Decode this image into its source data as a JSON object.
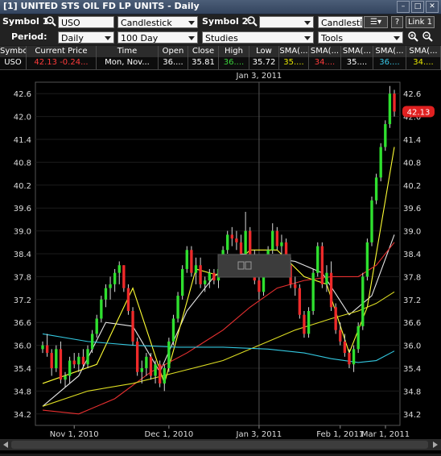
{
  "window": {
    "title": "[1] UNITED STS OIL FD LP UNITS - Daily"
  },
  "toolbar": {
    "symbol1_label": "Symbol 1:",
    "symbol1_value": "USO",
    "chart_type": "Candlestick",
    "symbol2_label": "Symbol 2:",
    "symbol2_value": "",
    "chart_type2": "Candlestic",
    "link_label": "Link 1",
    "help_label": "?",
    "period_label": "Period:",
    "period_value": "Daily",
    "range_value": "100 Day",
    "studies_value": "Studies",
    "tools_value": "Tools"
  },
  "quote": {
    "headers": [
      "Symbol",
      "Current Price",
      "Time",
      "Open",
      "Close",
      "High",
      "Low",
      "SMA(...",
      "SMA(...",
      "SMA(...",
      "SMA(...",
      "SMA(..."
    ],
    "values": [
      "USO",
      "42.13 -0.24...",
      "Mon, Nov...",
      "36....",
      "35.81",
      "36....",
      "35.72",
      "35....",
      "34....",
      "35....",
      "36....",
      "34...."
    ],
    "colors": [
      "#ffffff",
      "#ff3b3b",
      "#ffffff",
      "#ffffff",
      "#ffffff",
      "#3ad43a",
      "#ffffff",
      "#e8e800",
      "#ff3b3b",
      "#ffffff",
      "#38c8e8",
      "#e8e800"
    ]
  },
  "chart_data": {
    "type": "candlestick",
    "title": "",
    "cursor_label": "Jan 3, 2011",
    "current_price_label": "42.13",
    "ylim": [
      33.9,
      42.9
    ],
    "yticks": [
      "42.6",
      "42.0",
      "41.4",
      "40.8",
      "40.2",
      "39.6",
      "39.0",
      "38.4",
      "37.8",
      "37.2",
      "36.6",
      "36.0",
      "35.4",
      "34.8",
      "34.2"
    ],
    "xticks": [
      "Nov 1, 2010",
      "Dec 1, 2010",
      "Jan 3, 2011",
      "Feb 1, 2011",
      "Mar 1, 2011"
    ],
    "candles": [
      [
        35.9,
        36.1,
        35.8,
        36.0
      ],
      [
        36.0,
        36.3,
        35.7,
        35.8
      ],
      [
        35.8,
        35.9,
        35.2,
        35.4
      ],
      [
        35.4,
        36.0,
        35.3,
        35.9
      ],
      [
        35.9,
        36.1,
        35.0,
        35.1
      ],
      [
        35.1,
        35.3,
        34.9,
        35.2
      ],
      [
        35.2,
        35.7,
        35.0,
        35.6
      ],
      [
        35.6,
        35.8,
        35.4,
        35.5
      ],
      [
        35.5,
        35.8,
        35.3,
        35.7
      ],
      [
        35.7,
        35.9,
        35.4,
        35.5
      ],
      [
        35.5,
        36.0,
        35.4,
        35.9
      ],
      [
        35.9,
        36.4,
        35.8,
        36.3
      ],
      [
        36.3,
        36.8,
        36.2,
        36.7
      ],
      [
        36.7,
        37.3,
        36.6,
        37.2
      ],
      [
        37.2,
        37.6,
        37.0,
        37.5
      ],
      [
        37.5,
        37.8,
        37.2,
        37.6
      ],
      [
        37.6,
        38.0,
        37.4,
        37.9
      ],
      [
        37.9,
        38.2,
        37.6,
        38.1
      ],
      [
        38.1,
        38.1,
        37.4,
        37.5
      ],
      [
        37.5,
        37.6,
        36.8,
        36.9
      ],
      [
        36.9,
        37.0,
        36.0,
        36.1
      ],
      [
        36.1,
        36.2,
        35.2,
        35.3
      ],
      [
        35.3,
        35.6,
        35.0,
        35.4
      ],
      [
        35.4,
        35.8,
        35.2,
        35.7
      ],
      [
        35.7,
        35.8,
        35.1,
        35.2
      ],
      [
        35.2,
        35.6,
        35.0,
        35.5
      ],
      [
        35.5,
        35.6,
        34.9,
        35.0
      ],
      [
        35.0,
        35.5,
        34.8,
        35.4
      ],
      [
        35.4,
        36.2,
        35.3,
        36.1
      ],
      [
        36.1,
        36.8,
        36.0,
        36.7
      ],
      [
        36.7,
        37.4,
        36.6,
        37.3
      ],
      [
        37.3,
        38.1,
        37.2,
        38.0
      ],
      [
        38.0,
        38.6,
        37.9,
        38.5
      ],
      [
        38.5,
        38.6,
        37.8,
        37.9
      ],
      [
        37.9,
        38.3,
        37.6,
        38.1
      ],
      [
        38.1,
        38.3,
        37.5,
        37.6
      ],
      [
        37.6,
        37.8,
        37.4,
        37.7
      ],
      [
        37.7,
        38.0,
        37.5,
        37.9
      ],
      [
        37.9,
        38.0,
        37.6,
        37.7
      ],
      [
        37.7,
        38.1,
        37.5,
        38.0
      ],
      [
        38.0,
        38.6,
        37.9,
        38.5
      ],
      [
        38.5,
        39.0,
        38.4,
        38.9
      ],
      [
        38.9,
        39.1,
        38.6,
        38.8
      ],
      [
        38.8,
        39.0,
        38.5,
        38.7
      ],
      [
        38.7,
        38.9,
        38.3,
        38.4
      ],
      [
        38.4,
        39.5,
        38.3,
        39.0
      ],
      [
        39.0,
        39.1,
        38.1,
        38.2
      ],
      [
        38.2,
        38.5,
        37.6,
        37.7
      ],
      [
        37.7,
        37.9,
        37.2,
        37.4
      ],
      [
        37.4,
        38.1,
        37.3,
        38.0
      ],
      [
        38.0,
        38.6,
        37.9,
        38.5
      ],
      [
        38.5,
        39.2,
        38.4,
        39.0
      ],
      [
        39.0,
        39.1,
        38.5,
        38.6
      ],
      [
        38.6,
        38.9,
        38.4,
        38.7
      ],
      [
        38.7,
        38.8,
        38.0,
        38.1
      ],
      [
        38.1,
        38.3,
        37.5,
        37.6
      ],
      [
        37.6,
        37.8,
        37.3,
        37.5
      ],
      [
        37.5,
        37.6,
        36.7,
        36.8
      ],
      [
        36.8,
        36.9,
        36.2,
        36.3
      ],
      [
        36.3,
        37.0,
        36.2,
        36.9
      ],
      [
        36.9,
        38.0,
        36.8,
        37.9
      ],
      [
        37.9,
        38.7,
        37.8,
        38.6
      ],
      [
        38.6,
        38.7,
        37.5,
        37.6
      ],
      [
        37.6,
        38.1,
        37.4,
        37.9
      ],
      [
        37.9,
        38.2,
        36.9,
        37.0
      ],
      [
        37.0,
        37.1,
        36.3,
        36.4
      ],
      [
        36.4,
        36.6,
        36.0,
        36.1
      ],
      [
        36.1,
        36.3,
        35.7,
        35.8
      ],
      [
        35.8,
        35.9,
        35.4,
        35.5
      ],
      [
        35.5,
        36.0,
        35.3,
        35.9
      ],
      [
        35.9,
        36.6,
        35.8,
        36.5
      ],
      [
        36.5,
        37.9,
        36.4,
        37.8
      ],
      [
        37.8,
        38.8,
        37.7,
        38.7
      ],
      [
        38.7,
        39.9,
        38.6,
        39.8
      ],
      [
        39.8,
        40.5,
        39.7,
        40.4
      ],
      [
        40.4,
        41.3,
        40.3,
        41.2
      ],
      [
        41.2,
        41.9,
        41.1,
        41.8
      ],
      [
        41.8,
        42.8,
        41.7,
        42.6
      ],
      [
        42.6,
        42.7,
        42.0,
        42.13
      ]
    ],
    "series": [
      {
        "color": "#e6e6e6",
        "values": [
          [
            0,
            34.4
          ],
          [
            8,
            35.2
          ],
          [
            14,
            36.6
          ],
          [
            20,
            36.5
          ],
          [
            26,
            35.3
          ],
          [
            32,
            36.9
          ],
          [
            38,
            37.8
          ],
          [
            44,
            38.4
          ],
          [
            50,
            38.3
          ],
          [
            56,
            38.2
          ],
          [
            62,
            37.9
          ],
          [
            68,
            36.8
          ],
          [
            73,
            37.3
          ],
          [
            78,
            38.9
          ]
        ]
      },
      {
        "color": "#ffff33",
        "values": [
          [
            0,
            35.0
          ],
          [
            12,
            35.5
          ],
          [
            20,
            37.5
          ],
          [
            27,
            35.0
          ],
          [
            34,
            38.0
          ],
          [
            40,
            37.8
          ],
          [
            46,
            38.5
          ],
          [
            52,
            38.5
          ],
          [
            58,
            37.8
          ],
          [
            63,
            37.6
          ],
          [
            68,
            35.8
          ],
          [
            72,
            37.0
          ],
          [
            78,
            41.2
          ]
        ]
      },
      {
        "color": "#e83030",
        "values": [
          [
            0,
            34.3
          ],
          [
            8,
            34.2
          ],
          [
            16,
            34.6
          ],
          [
            24,
            35.3
          ],
          [
            32,
            35.8
          ],
          [
            40,
            36.4
          ],
          [
            46,
            37.0
          ],
          [
            52,
            37.5
          ],
          [
            58,
            37.7
          ],
          [
            64,
            37.8
          ],
          [
            70,
            37.8
          ],
          [
            74,
            38.1
          ],
          [
            78,
            38.7
          ]
        ]
      },
      {
        "color": "#dddd22",
        "values": [
          [
            0,
            34.4
          ],
          [
            10,
            34.8
          ],
          [
            20,
            35.0
          ],
          [
            30,
            35.3
          ],
          [
            40,
            35.6
          ],
          [
            48,
            36.0
          ],
          [
            56,
            36.4
          ],
          [
            64,
            36.7
          ],
          [
            70,
            36.9
          ],
          [
            74,
            37.1
          ],
          [
            78,
            37.4
          ]
        ]
      },
      {
        "color": "#33c8e0",
        "values": [
          [
            0,
            36.3
          ],
          [
            10,
            36.1
          ],
          [
            20,
            36.0
          ],
          [
            30,
            35.95
          ],
          [
            40,
            35.95
          ],
          [
            50,
            35.9
          ],
          [
            58,
            35.8
          ],
          [
            64,
            35.65
          ],
          [
            70,
            35.55
          ],
          [
            74,
            35.6
          ],
          [
            78,
            35.85
          ]
        ]
      }
    ]
  }
}
